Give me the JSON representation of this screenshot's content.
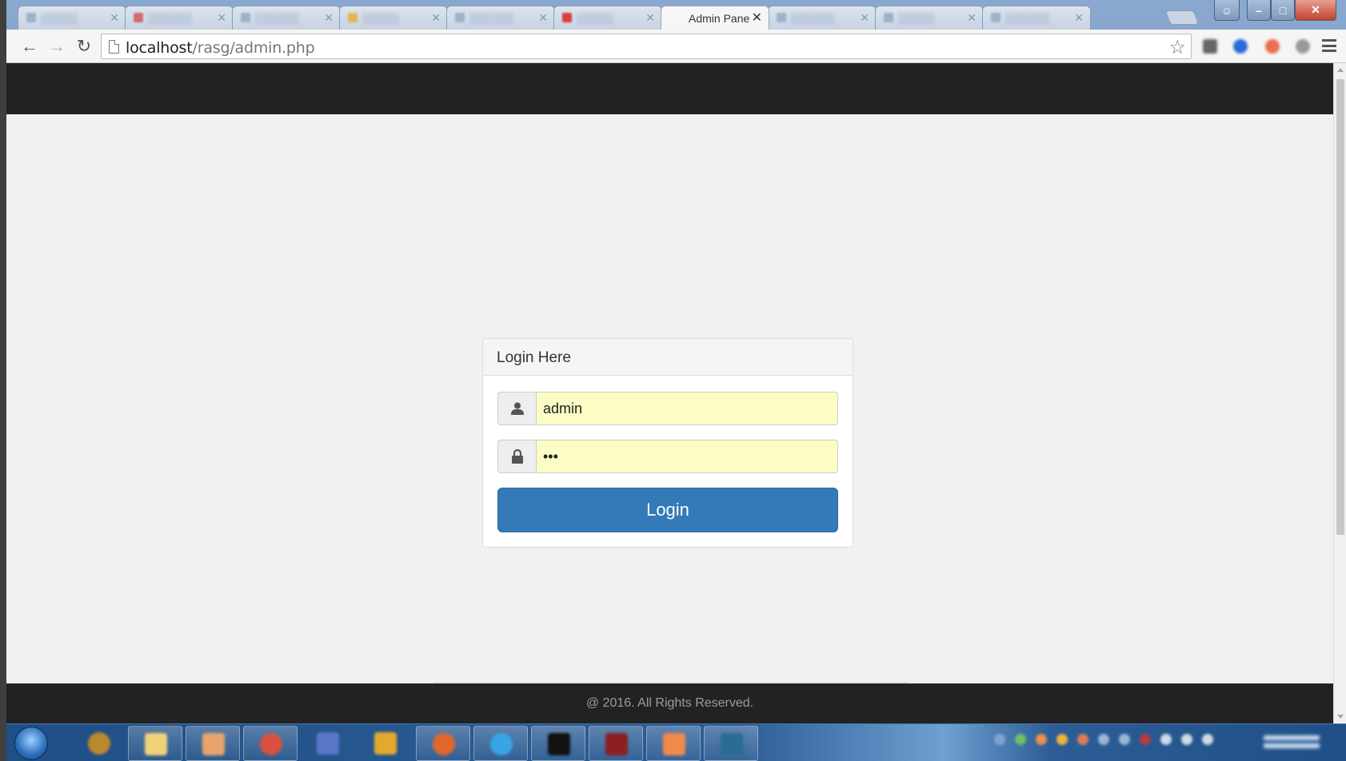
{
  "browser": {
    "active_tab_title": "Admin Pane",
    "url_host": "localhost",
    "url_path": "/rasg/admin.php"
  },
  "login": {
    "heading": "Login Here",
    "username_value": "admin",
    "password_value": "***",
    "button_label": "Login"
  },
  "footer": {
    "text": "@ 2016. All Rights Reserved."
  },
  "colors": {
    "navbar": "#222222",
    "button": "#337ab7",
    "autofill": "#fbfdc4"
  }
}
